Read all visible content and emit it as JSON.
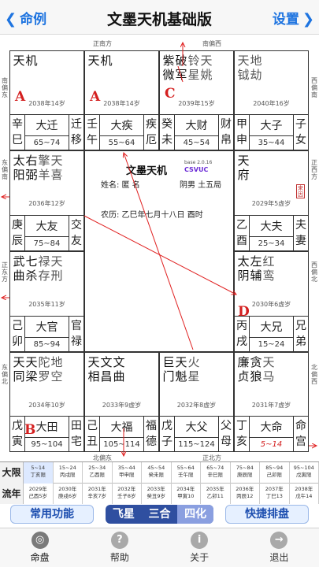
{
  "nav": {
    "back_label": "命例",
    "title": "文墨天机基础版",
    "settings_label": "设置"
  },
  "directions": {
    "top": [
      "正南方",
      "南偏西"
    ],
    "bottom": [
      "北偏东",
      "正北方"
    ],
    "left": [
      "南偏东",
      "东偏南",
      "正东方",
      "东偏北"
    ],
    "right": [
      "西偏南",
      "正西方",
      "西偏北",
      "北偏西"
    ]
  },
  "palaces": [
    {
      "id": "si",
      "stars_main": [
        "天机"
      ],
      "stars_minor": [],
      "letter": "A",
      "yearage": "2038年14岁",
      "gz": [
        "辛",
        "巳"
      ],
      "dy": "大迁",
      "range": "65~74",
      "name": [
        "迁",
        "移"
      ]
    },
    {
      "id": "wu",
      "stars_main": [
        "天机"
      ],
      "stars_minor": [],
      "letter": "A",
      "yearage": "2038年14岁",
      "gz": [
        "壬",
        "午"
      ],
      "dy": "大疾",
      "range": "55~64",
      "name": [
        "疾",
        "厄"
      ]
    },
    {
      "id": "wei",
      "stars_main": [
        "紫破",
        "微军"
      ],
      "stars_minor": [
        "铃天",
        "星姚"
      ],
      "letter": "C",
      "yearage": "2039年15岁",
      "gz": [
        "癸",
        "未"
      ],
      "dy": "大财",
      "range": "45~54",
      "name": [
        "财",
        "帛"
      ]
    },
    {
      "id": "shen",
      "stars_main": [],
      "stars_minor": [
        "天地",
        "钺劫"
      ],
      "letter": "",
      "yearage": "2040年16岁",
      "gz": [
        "甲",
        "申"
      ],
      "dy": "大子",
      "range": "35~44",
      "name": [
        "子",
        "女"
      ]
    },
    {
      "id": "chen",
      "stars_main": [
        "太右",
        "阳弼"
      ],
      "stars_minor": [
        "擎天",
        "羊喜"
      ],
      "letter": "",
      "yearage": "2036年12岁",
      "gz": [
        "庚",
        "辰"
      ],
      "dy": "大友",
      "range": "75~84",
      "name": [
        "交",
        "友"
      ]
    },
    {
      "id": "you",
      "stars_main": [
        "天",
        "府"
      ],
      "stars_minor": [],
      "letter": "",
      "yearage": "2029年5虚岁",
      "gz": [
        "乙",
        "酉"
      ],
      "dy": "大夫",
      "range": "25~34",
      "name": [
        "夫",
        "妻"
      ]
    },
    {
      "id": "mao",
      "stars_main": [
        "武七",
        "曲杀"
      ],
      "stars_minor": [
        "禄天",
        "存刑"
      ],
      "letter": "",
      "yearage": "2035年11岁",
      "gz": [
        "己",
        "卯"
      ],
      "dy": "大官",
      "range": "85~94",
      "name": [
        "官",
        "禄"
      ]
    },
    {
      "id": "xu",
      "stars_main": [
        "太左",
        "阴辅"
      ],
      "stars_minor": [
        "红",
        "鸾"
      ],
      "letter": "D",
      "yearage": "2030年6虚岁",
      "gz": [
        "丙",
        "戌"
      ],
      "dy": "大兄",
      "range": "15~24",
      "name": [
        "兄",
        "弟"
      ]
    },
    {
      "id": "yin",
      "stars_main": [
        "天天",
        "同梁"
      ],
      "stars_minor": [
        "陀地",
        "罗空"
      ],
      "letter": "B",
      "yearage": "2034年10岁",
      "gz": [
        "戊",
        "寅"
      ],
      "dy": "大田",
      "range": "95~104",
      "name": [
        "田",
        "宅"
      ]
    },
    {
      "id": "chou",
      "stars_main": [
        "天文文",
        "相昌曲"
      ],
      "stars_minor": [],
      "letter": "",
      "yearage": "2033年9虚岁",
      "gz": [
        "己",
        "丑"
      ],
      "dy": "大福",
      "range": "105~114",
      "name": [
        "福",
        "德"
      ]
    },
    {
      "id": "zi",
      "stars_main": [
        "巨天",
        "门魁"
      ],
      "stars_minor": [
        "火",
        "星"
      ],
      "letter": "",
      "yearage": "2032年8虚岁",
      "gz": [
        "戊",
        "子"
      ],
      "dy": "大父",
      "range": "115~124",
      "name": [
        "父",
        "母"
      ]
    },
    {
      "id": "hai",
      "stars_main": [
        "廉贪",
        "贞狼"
      ],
      "stars_minor": [
        "天",
        "马"
      ],
      "letter": "",
      "yearage": "2031年7虚岁",
      "gz": [
        "丁",
        "亥"
      ],
      "dy": "大命",
      "range": "5~14",
      "name": [
        "命",
        "宫"
      ]
    }
  ],
  "center": {
    "title": "文墨天机",
    "version": "base 2.0.16",
    "code": "CSVUC",
    "info": "姓名: 匿 名",
    "wuju": "阴男 土五局",
    "lunar": "农历: 乙巳年七月十八日 酉时",
    "stamp": "来因"
  },
  "daxian": {
    "label": "大限",
    "cells": [
      [
        "5~14",
        "丁亥限"
      ],
      [
        "15~24",
        "丙戌限"
      ],
      [
        "25~34",
        "乙酉限"
      ],
      [
        "35~44",
        "甲申限"
      ],
      [
        "45~54",
        "癸未限"
      ],
      [
        "55~64",
        "壬午限"
      ],
      [
        "65~74",
        "辛巳限"
      ],
      [
        "75~84",
        "庚辰限"
      ],
      [
        "85~94",
        "己卯限"
      ],
      [
        "95~104",
        "戊寅限"
      ]
    ]
  },
  "liunian": {
    "label": "流年",
    "cells": [
      [
        "2029年",
        "己酉5岁"
      ],
      [
        "2030年",
        "庚戌6岁"
      ],
      [
        "2031年",
        "辛亥7岁"
      ],
      [
        "2032年",
        "壬子8岁"
      ],
      [
        "2033年",
        "癸丑9岁"
      ],
      [
        "2034年",
        "甲寅10"
      ],
      [
        "2035年",
        "乙卯11"
      ],
      [
        "2036年",
        "丙辰12"
      ],
      [
        "2037年",
        "丁巳13"
      ],
      [
        "2038年",
        "戊午14"
      ]
    ]
  },
  "modes": {
    "func_label": "常用功能",
    "seg": [
      "飞星",
      "三合",
      "四化"
    ],
    "active_seg": 2,
    "quick_label": "快捷排盘"
  },
  "tabs": [
    {
      "label": "命盘",
      "icon": "chart-disc-icon",
      "glyph": "◎"
    },
    {
      "label": "帮助",
      "icon": "help-icon",
      "glyph": "?"
    },
    {
      "label": "关于",
      "icon": "info-icon",
      "glyph": "i"
    },
    {
      "label": "退出",
      "icon": "exit-icon",
      "glyph": "→"
    }
  ]
}
